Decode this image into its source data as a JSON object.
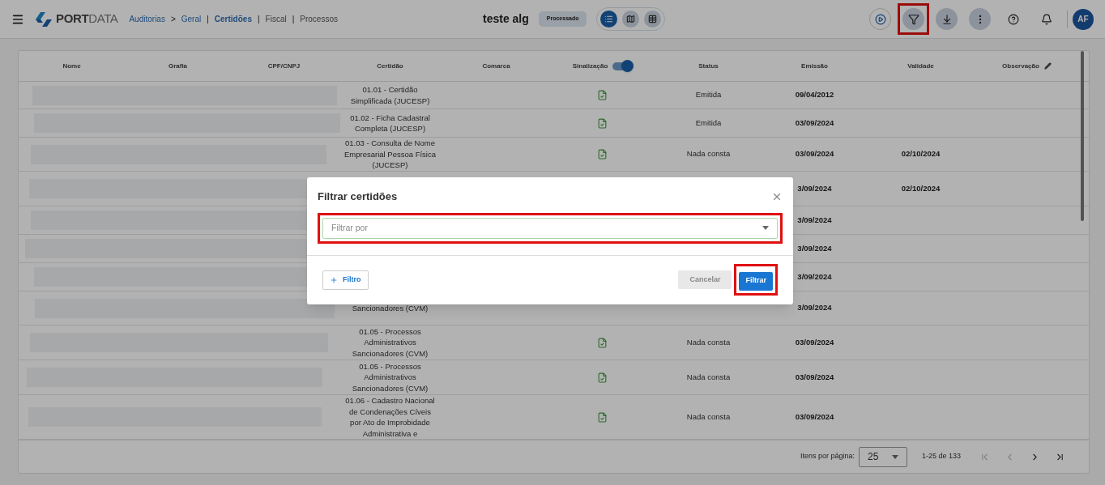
{
  "header": {
    "logo": {
      "bold": "PORT",
      "light": "DATA"
    },
    "breadcrumb": [
      {
        "label": "Auditorias",
        "kind": "link",
        "selected": false
      },
      {
        "label": "Geral",
        "kind": "link",
        "separator": ">",
        "selected": false
      },
      {
        "label": "Certidões",
        "kind": "link",
        "separator": "|",
        "selected": true
      },
      {
        "label": "Fiscal",
        "kind": "plain",
        "separator": "|",
        "selected": false
      },
      {
        "label": "Processos",
        "kind": "plain",
        "separator": "|",
        "selected": false
      }
    ],
    "title": "teste alg",
    "status_badge": "Processado",
    "view_toggles": [
      {
        "kind": "list",
        "selected": true
      },
      {
        "kind": "map",
        "selected": false
      },
      {
        "kind": "grid",
        "selected": false
      }
    ],
    "actions": [
      {
        "kind": "play",
        "highlighted": false
      },
      {
        "kind": "filter",
        "highlighted": true
      },
      {
        "kind": "download",
        "highlighted": false
      },
      {
        "kind": "more",
        "highlighted": false
      },
      {
        "kind": "help",
        "highlighted": false
      },
      {
        "kind": "bell",
        "highlighted": false
      }
    ],
    "user": {
      "initials": "AF"
    }
  },
  "table": {
    "columns": [
      {
        "label": "Nome",
        "kind": "plain"
      },
      {
        "label": "Grafia",
        "kind": "plain"
      },
      {
        "label": "CPF/CNPJ",
        "kind": "plain"
      },
      {
        "label": "Certidão",
        "kind": "plain"
      },
      {
        "label": "Comarca",
        "kind": "plain"
      },
      {
        "label": "Sinalização",
        "kind": "toggle",
        "on": true
      },
      {
        "label": "Status",
        "kind": "plain"
      },
      {
        "label": "Emissão",
        "kind": "plain"
      },
      {
        "label": "Validade",
        "kind": "plain"
      },
      {
        "label": "Observação",
        "kind": "edit"
      }
    ],
    "rows": [
      {
        "certidao": "01.01 - Certidão Simplificada (JUCESP)",
        "status": "Emitida",
        "emissao": "09/04/2012"
      },
      {
        "certidao": "01.02 - Ficha Cadastral Completa (JUCESP)",
        "status": "Emitida",
        "emissao": "03/09/2024"
      },
      {
        "certidao": "01.03 - Consulta de Nome Empresarial Pessoa Física (JUCESP)",
        "status": "Nada consta",
        "emissao": "03/09/2024",
        "validade": "02/10/2024"
      },
      {
        "emissao": "3/09/2024",
        "validade": "02/10/2024"
      },
      {
        "emissao": "3/09/2024"
      },
      {
        "emissao": "3/09/2024"
      },
      {
        "emissao": "3/09/2024"
      },
      {
        "certidao": "Sancionadores (CVM)",
        "emissao": "3/09/2024"
      },
      {
        "certidao": "01.05 - Processos Administrativos Sancionadores (CVM)",
        "status": "Nada consta",
        "emissao": "03/09/2024"
      },
      {
        "certidao": "01.05 - Processos Administrativos Sancionadores (CVM)",
        "status": "Nada consta",
        "emissao": "03/09/2024"
      },
      {
        "certidao": "01.06 - Cadastro Nacional de Condenações Cíveis por Ato de Improbidade Administrativa e",
        "status": "Nada consta",
        "emissao": "03/09/2024"
      }
    ]
  },
  "pagination": {
    "label": "Itens por página:",
    "page_size": "25",
    "range": "1-25 de 133",
    "buttons": [
      {
        "kind": "first",
        "disabled": true
      },
      {
        "kind": "prev",
        "disabled": true
      },
      {
        "kind": "next",
        "disabled": false
      },
      {
        "kind": "last",
        "disabled": false
      }
    ]
  },
  "dialog": {
    "title": "Filtrar certidões",
    "field": {
      "placeholder": "Filtrar por",
      "highlighted": true
    },
    "add_button": "Filtro",
    "cancel_button": "Cancelar",
    "submit_button": {
      "label": "Filtrar",
      "highlighted": true
    }
  }
}
